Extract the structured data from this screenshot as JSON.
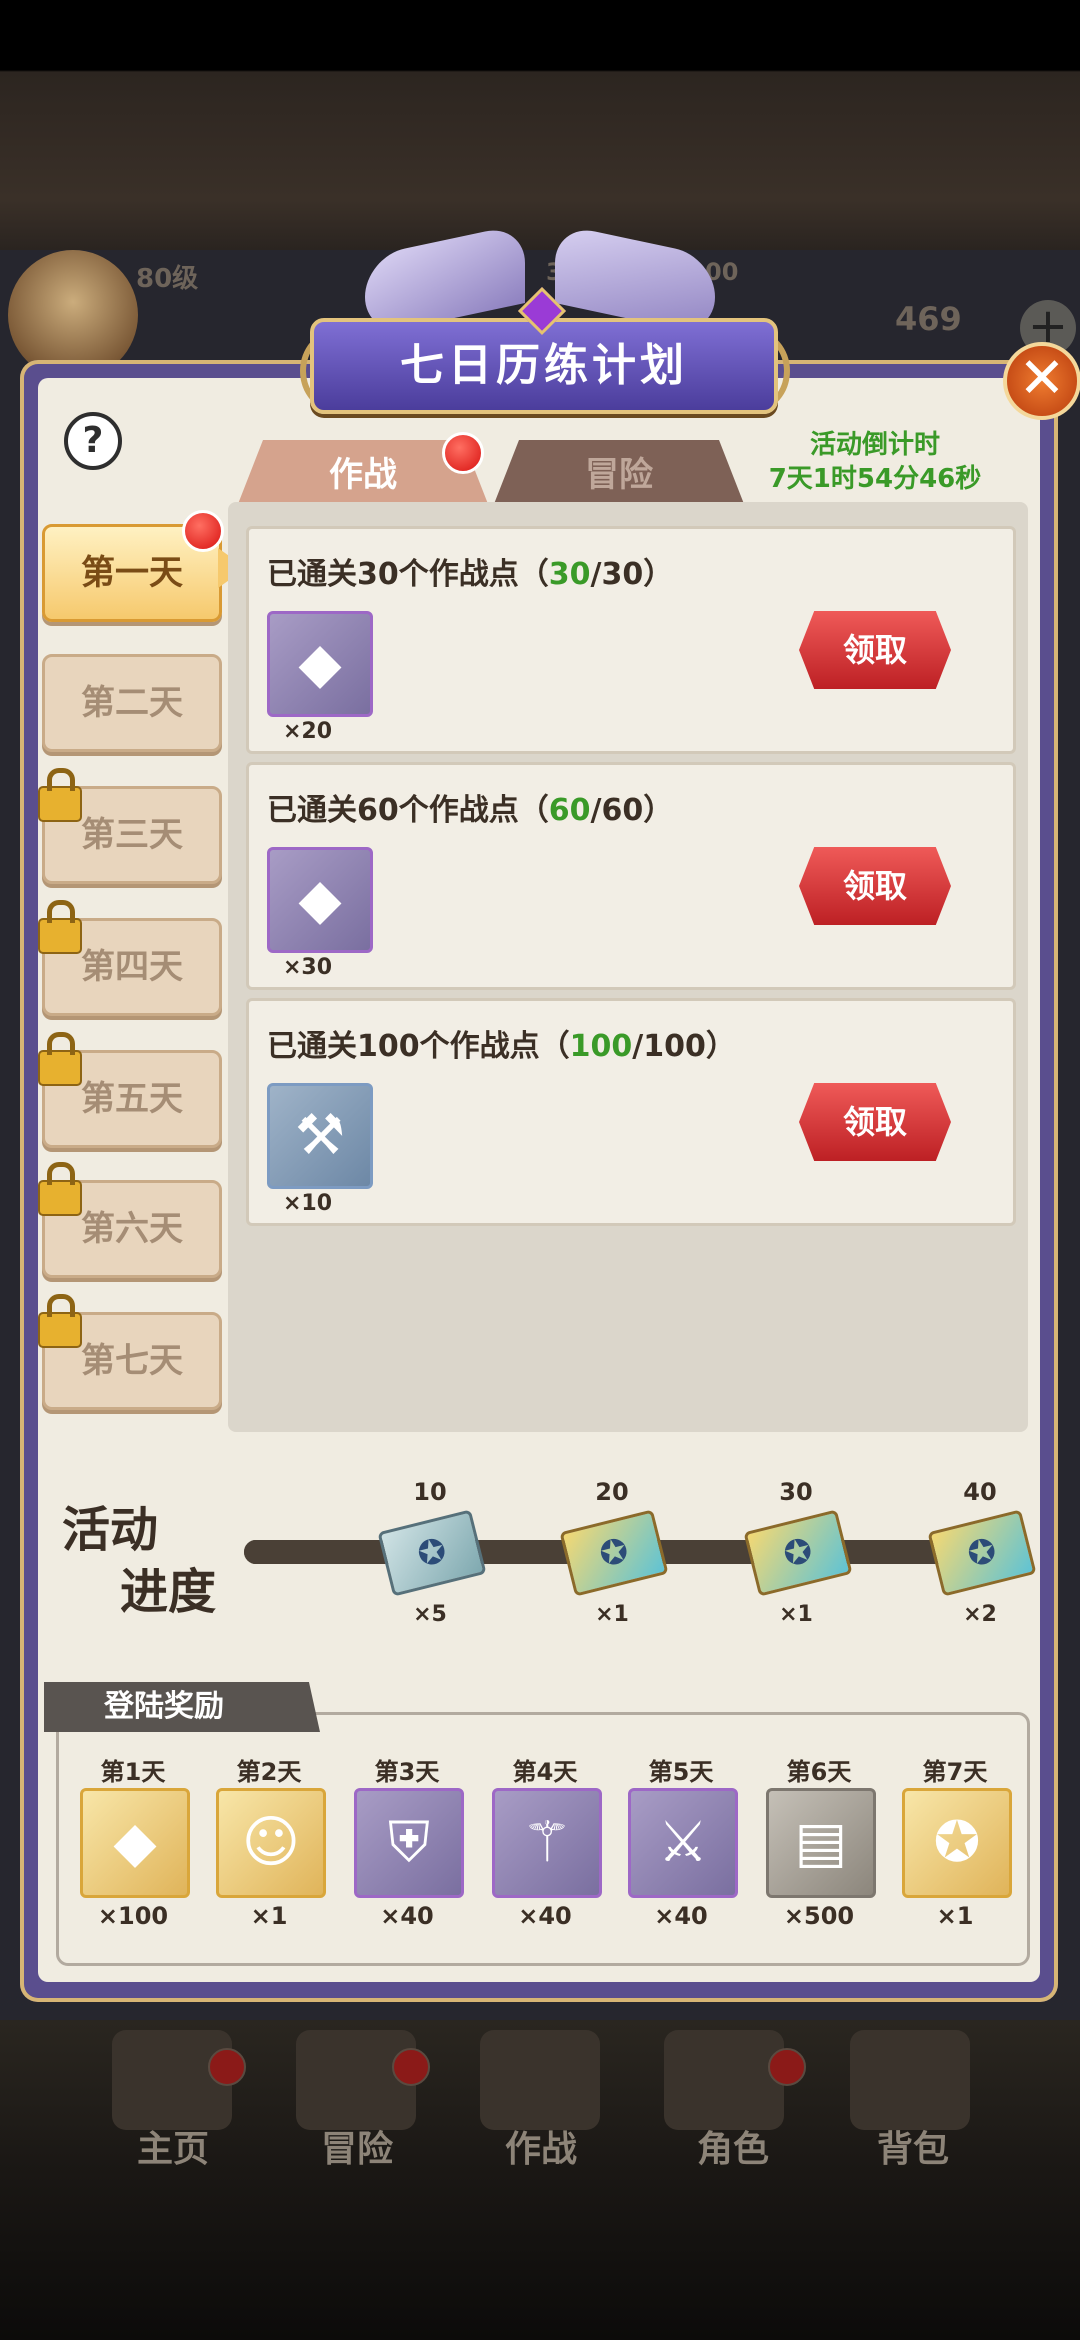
{
  "header": {
    "level": "80级",
    "exp": "3511/2139000",
    "gems": "469",
    "plus": "+"
  },
  "title": "七日历练计划",
  "close": "✕",
  "help": "?",
  "tabs": [
    {
      "label": "作战",
      "active": true,
      "badge": true
    },
    {
      "label": "冒险",
      "active": false,
      "badge": false
    }
  ],
  "countdown": {
    "label": "活动倒计时",
    "value": "7天1时54分46秒"
  },
  "days": [
    {
      "label": "第一天",
      "active": true,
      "locked": false,
      "badge": true
    },
    {
      "label": "第二天",
      "active": false,
      "locked": false,
      "badge": false
    },
    {
      "label": "第三天",
      "active": false,
      "locked": true,
      "badge": false
    },
    {
      "label": "第四天",
      "active": false,
      "locked": true,
      "badge": false
    },
    {
      "label": "第五天",
      "active": false,
      "locked": true,
      "badge": false
    },
    {
      "label": "第六天",
      "active": false,
      "locked": true,
      "badge": false
    },
    {
      "label": "第七天",
      "active": false,
      "locked": true,
      "badge": false
    }
  ],
  "tasks": [
    {
      "prefix": "已通关30个作战点（",
      "done": "30",
      "total": "/30）",
      "item": "rainbow-gem-icon",
      "qty": "×20",
      "button": "领取"
    },
    {
      "prefix": "已通关60个作战点（",
      "done": "60",
      "total": "/60）",
      "item": "rainbow-gem-icon",
      "qty": "×30",
      "button": "领取"
    },
    {
      "prefix": "已通关100个作战点（",
      "done": "100",
      "total": "/100）",
      "item": "hammer-icon",
      "qty": "×10",
      "button": "领取"
    }
  ],
  "progress": {
    "label_line1": "活动",
    "label_line2": "进度",
    "milestones": [
      {
        "value": "10",
        "qty": "×5",
        "ticket": "silver-ticket-icon"
      },
      {
        "value": "20",
        "qty": "×1",
        "ticket": "gold-ticket-icon"
      },
      {
        "value": "30",
        "qty": "×1",
        "ticket": "gold-ticket-icon"
      },
      {
        "value": "40",
        "qty": "×2",
        "ticket": "gold-ticket-icon"
      }
    ]
  },
  "login": {
    "title": "登陆奖励",
    "rewards": [
      {
        "day": "第1天",
        "qty": "×100",
        "icon": "rainbow-gem-icon",
        "style": "gold"
      },
      {
        "day": "第2天",
        "qty": "×1",
        "icon": "character-portrait-icon",
        "style": "gold"
      },
      {
        "day": "第3天",
        "qty": "×40",
        "icon": "shield-icon",
        "style": "purple"
      },
      {
        "day": "第4天",
        "qty": "×40",
        "icon": "staff-icon",
        "style": "purple"
      },
      {
        "day": "第5天",
        "qty": "×40",
        "icon": "sword-icon",
        "style": "purple"
      },
      {
        "day": "第6天",
        "qty": "×500",
        "icon": "book-icon",
        "style": "grey"
      },
      {
        "day": "第7天",
        "qty": "×1",
        "icon": "gold-ticket-icon",
        "style": "gold"
      }
    ]
  },
  "nav": [
    {
      "label": "主页",
      "badge": true
    },
    {
      "label": "冒险",
      "badge": true
    },
    {
      "label": "作战",
      "badge": false
    },
    {
      "label": "角色",
      "badge": true
    },
    {
      "label": "背包",
      "badge": false
    }
  ]
}
